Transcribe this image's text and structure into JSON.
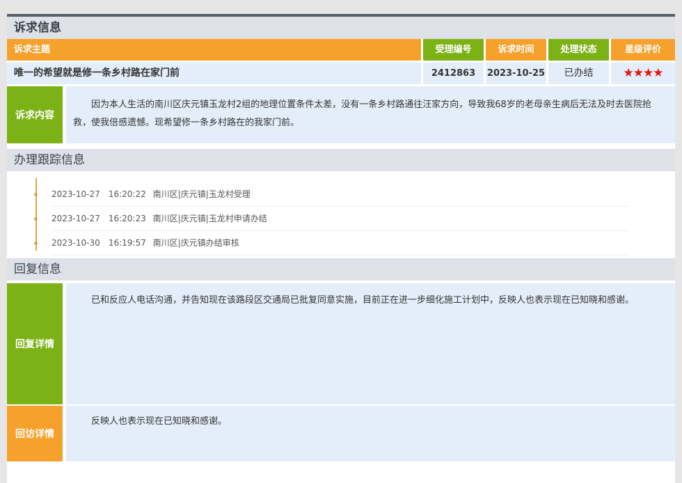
{
  "appeal": {
    "section_title": "诉求信息",
    "headers": {
      "topic": "诉求主题",
      "id": "受理编号",
      "time": "诉求时间",
      "status": "处理状态",
      "rating": "星级评价"
    },
    "topic": "唯一的希望就是修一条乡村路在家门前",
    "id": "2412863",
    "time": "2023-10-25",
    "status": "已办结",
    "rating_stars": "★★★★",
    "rating_value": 4,
    "content_label": "诉求内容",
    "content": "因为本人生活的南川区庆元镇玉龙村2组的地理位置条件太差，没有一条乡村路通往汪家方向，导致我68岁的老母亲生病后无法及时去医院抢救，使我倍感遗憾。现希望修一条乡村路在的我家门前。"
  },
  "tracking": {
    "section_title": "办理跟踪信息",
    "items": [
      {
        "date": "2023-10-27",
        "time": "16:20:22",
        "text": "南川区|庆元镇|玉龙村受理"
      },
      {
        "date": "2023-10-27",
        "time": "16:20:23",
        "text": "南川区|庆元镇|玉龙村申请办结"
      },
      {
        "date": "2023-10-30",
        "time": "16:19:57",
        "text": "南川区|庆元镇办结审核"
      }
    ]
  },
  "reply": {
    "section_title": "回复信息",
    "detail_label": "回复详情",
    "detail": "已和反应人电话沟通，并告知现在该路段区交通局已批复同意实施，目前正在进一步细化施工计划中，反映人也表示现在已知晓和感谢。",
    "revisit_label": "回访详情",
    "revisit": "反映人也表示现在已知晓和感谢。"
  },
  "colors": {
    "orange": "#f7a12d",
    "green": "#7cb216",
    "light_blue": "#e4eefa",
    "header_gray": "#dfe1e8",
    "star_red": "#e8140f"
  }
}
